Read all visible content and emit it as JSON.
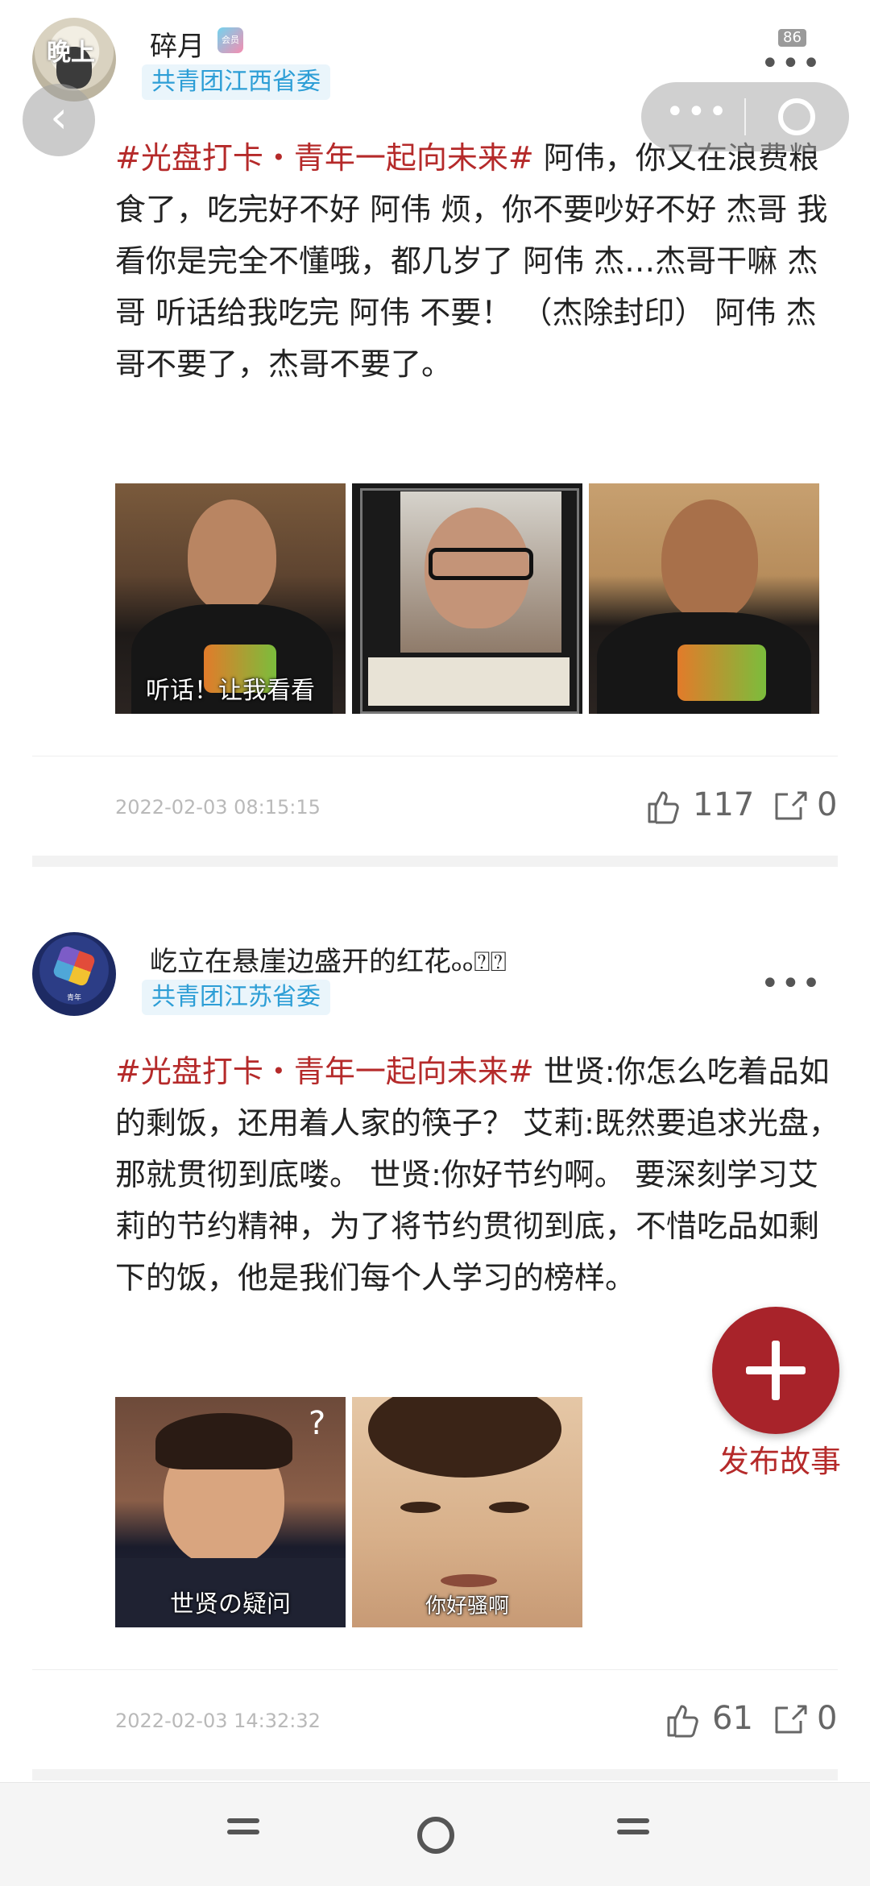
{
  "window": {
    "counter": "86"
  },
  "overlay": {
    "back_icon": "chevron-left-icon",
    "menu_icon": "dots-icon",
    "close_icon": "circle-icon"
  },
  "posts": [
    {
      "avatar_text": "晚上",
      "username": "碎月",
      "badge": "共青团江西省委",
      "vip_label": "会员",
      "hashtag": "#光盘打卡・青年一起向未来#",
      "body": " 阿伟，你又在浪费粮食了，吃完好不好 阿伟 烦，你不要吵好不好 杰哥 我看你是完全不懂哦，都几岁了 阿伟 杰…杰哥干嘛 杰哥 听话给我吃完 阿伟 不要！ （杰除封印） 阿伟 杰哥不要了，杰哥不要了。",
      "images": [
        {
          "caption": "听话！让我看看"
        },
        {
          "caption": ""
        },
        {
          "caption": ""
        }
      ],
      "timestamp": "2022-02-03 08:15:15",
      "likes": "117",
      "shares": "0"
    },
    {
      "avatar_text": "青年",
      "username": "屹立在悬崖边盛开的红花ₒₒ⍰⍰",
      "badge": "共青团江苏省委",
      "hashtag": "#光盘打卡・青年一起向未来#",
      "body": " 世贤:你怎么吃着品如的剩饭，还用着人家的筷子？ 艾莉:既然要追求光盘，那就贯彻到底喽。 世贤:你好节约啊。 要深刻学习艾莉的节约精神，为了将节约贯彻到底，不惜吃品如剩下的饭，他是我们每个人学习的榜样。",
      "images": [
        {
          "caption": "世贤の疑问"
        },
        {
          "caption": "你好骚啊"
        }
      ],
      "timestamp": "2022-02-03 14:32:32",
      "likes": "61",
      "shares": "0"
    }
  ],
  "fab": {
    "label": "发布故事"
  },
  "colors": {
    "accent": "#a8232a",
    "hashtag": "#b52a2a",
    "badge_text": "#2d9ed6",
    "badge_bg": "#eaf5fb"
  }
}
